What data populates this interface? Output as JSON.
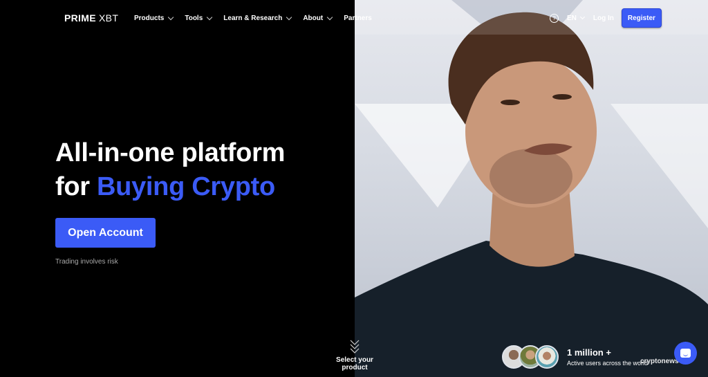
{
  "nav": {
    "logo_bold": "PRIME",
    "logo_light": "XBT",
    "menu": [
      {
        "label": "Products"
      },
      {
        "label": "Tools"
      },
      {
        "label": "Learn & Research"
      },
      {
        "label": "About"
      },
      {
        "label": "Partners"
      }
    ],
    "help_glyph": "?",
    "language": "EN",
    "login_label": "Log In",
    "register_label": "Register"
  },
  "hero": {
    "headline_line1": "All-in-one platform",
    "headline_line2_prefix": "for ",
    "headline_accent": "Buying Crypto",
    "cta_label": "Open Account",
    "risk_note": "Trading involves risk"
  },
  "scroll": {
    "label": "Select your product",
    "icon": "triple-chevron-down-icon"
  },
  "social_proof": {
    "count": "1 million +",
    "caption": "Active users across the world"
  },
  "watermark": "cryptonews",
  "chat": {
    "icon": "chat-icon"
  },
  "colors": {
    "accent": "#3b5bf6",
    "background": "#000000",
    "text": "#ffffff"
  }
}
